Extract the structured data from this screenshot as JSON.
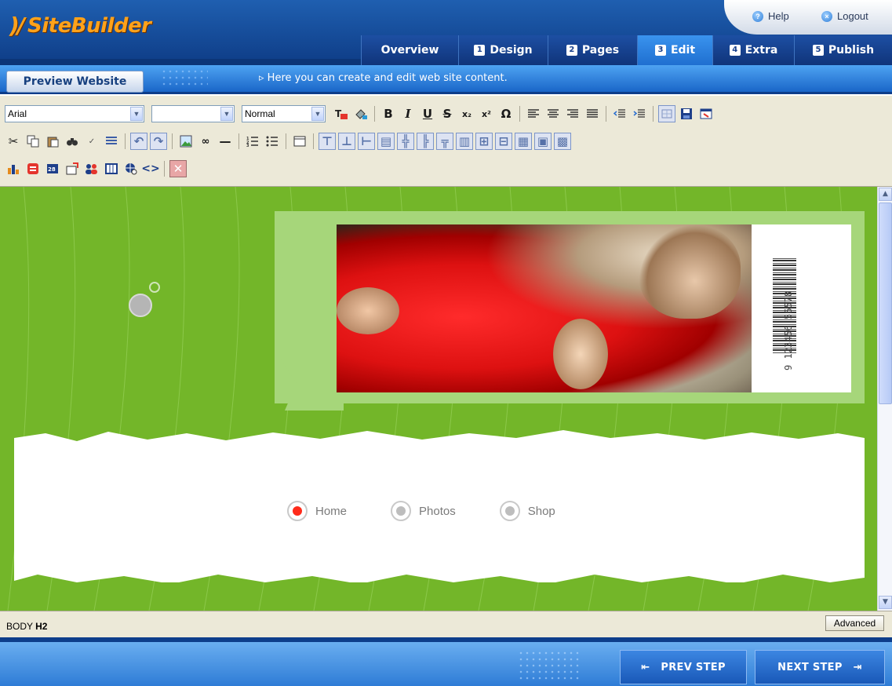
{
  "app": {
    "logo_mark": ")/",
    "logo_name": "SiteBuilder"
  },
  "header": {
    "help_label": "Help",
    "logout_label": "Logout"
  },
  "tabs": [
    {
      "label": "Overview",
      "num": ""
    },
    {
      "label": "Design",
      "num": "1"
    },
    {
      "label": "Pages",
      "num": "2"
    },
    {
      "label": "Edit",
      "num": "3",
      "active": true
    },
    {
      "label": "Extra",
      "num": "4"
    },
    {
      "label": "Publish",
      "num": "5"
    }
  ],
  "subbar": {
    "preview_label": "Preview Website",
    "hint": "Here you can create and edit web site content."
  },
  "toolbar": {
    "font_value": "Arial",
    "size_value": "",
    "style_value": "Normal"
  },
  "page": {
    "barcode_number": "9 123456 56578",
    "nav": [
      {
        "label": "Home",
        "active": true
      },
      {
        "label": "Photos",
        "active": false
      },
      {
        "label": "Shop",
        "active": false
      }
    ]
  },
  "status": {
    "path_body": "BODY",
    "path_tag": "H2",
    "advanced_label": "Advanced"
  },
  "footer": {
    "prev_label": "PREV STEP",
    "next_label": "NEXT STEP"
  },
  "colors": {
    "header_blue": "#1f5fb0",
    "active_tab": "#2f86e6",
    "logo_orange": "#ffa21a",
    "canvas_green": "#73b629",
    "nav_active_dot": "#ff2b1a"
  }
}
